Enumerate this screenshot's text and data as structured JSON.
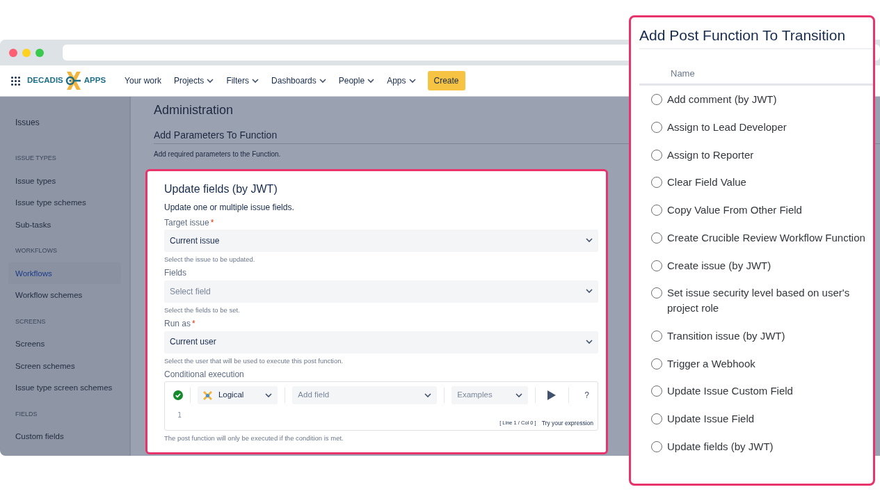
{
  "navbar": {
    "logo": {
      "left": "DECADIS",
      "right": "APPS"
    },
    "items": [
      {
        "label": "Your work",
        "dropdown": false
      },
      {
        "label": "Projects",
        "dropdown": true
      },
      {
        "label": "Filters",
        "dropdown": true
      },
      {
        "label": "Dashboards",
        "dropdown": true
      },
      {
        "label": "People",
        "dropdown": true
      },
      {
        "label": "Apps",
        "dropdown": true
      }
    ],
    "create_button": "Create"
  },
  "sidebar": {
    "title": "Issues",
    "sections": [
      {
        "heading": "ISSUE TYPES",
        "items": [
          {
            "label": "Issue types",
            "selected": false
          },
          {
            "label": "Issue type schemes",
            "selected": false
          },
          {
            "label": "Sub-tasks",
            "selected": false
          }
        ]
      },
      {
        "heading": "WORKFLOWS",
        "items": [
          {
            "label": "Workflows",
            "selected": true
          },
          {
            "label": "Workflow schemes",
            "selected": false
          }
        ]
      },
      {
        "heading": "SCREENS",
        "items": [
          {
            "label": "Screens",
            "selected": false
          },
          {
            "label": "Screen schemes",
            "selected": false
          },
          {
            "label": "Issue type screen schemes",
            "selected": false
          }
        ]
      },
      {
        "heading": "FIELDS",
        "items": [
          {
            "label": "Custom fields",
            "selected": false
          }
        ]
      }
    ]
  },
  "main": {
    "title": "Administration",
    "subtitle": "Add Parameters To Function",
    "description": "Add required parameters to the Function.",
    "card": {
      "title": "Update fields (by JWT)",
      "description": "Update one or multiple issue fields.",
      "fields": [
        {
          "label": "Target issue",
          "required_mark": "*",
          "value": "Current issue",
          "help": "Select the issue to be updated."
        },
        {
          "label": "Fields",
          "placeholder": "Select field",
          "help": "Select the fields to be set."
        },
        {
          "label": "Run as",
          "required_mark": "*",
          "value": "Current user",
          "help": "Select the user that will be used to execute this post function."
        }
      ],
      "conditional": {
        "label": "Conditional execution",
        "valid": true,
        "mode": "Logical",
        "field_placeholder": "Add field",
        "examples": "Examples",
        "help_button": "?",
        "line_number": "1",
        "position": "[ Line 1 / Col 0 ]",
        "try_link": "Try your expression",
        "help": "The post function will only be executed if the condition is met."
      }
    }
  },
  "panel": {
    "title": "Add Post Function To Transition",
    "column_header": "Name",
    "options": [
      {
        "label": "Add comment (by JWT)",
        "selected": false
      },
      {
        "label": "Assign to Lead Developer",
        "selected": false
      },
      {
        "label": "Assign to Reporter",
        "selected": false
      },
      {
        "label": "Clear Field Value",
        "selected": false
      },
      {
        "label": "Copy Value From Other Field",
        "selected": false
      },
      {
        "label": "Create Crucible Review Workflow Function",
        "selected": false
      },
      {
        "label": "Create issue (by JWT)",
        "selected": false
      },
      {
        "label": "Set issue security level based on user's project role",
        "selected": false
      },
      {
        "label": "Transition issue (by JWT)",
        "selected": false
      },
      {
        "label": "Trigger a Webhook",
        "selected": false
      },
      {
        "label": "Update Issue Custom Field",
        "selected": false
      },
      {
        "label": "Update Issue Field",
        "selected": false
      },
      {
        "label": "Update fields (by JWT)",
        "selected": false
      }
    ]
  }
}
